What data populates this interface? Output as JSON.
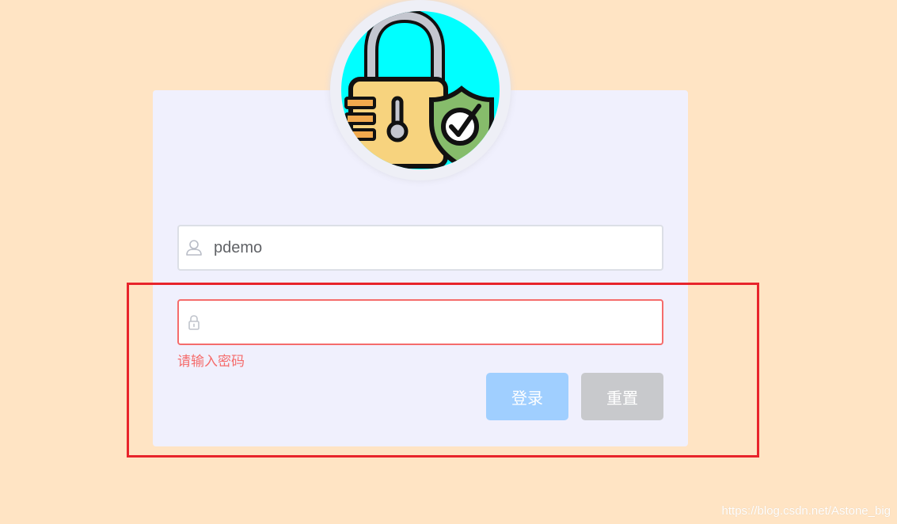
{
  "login": {
    "username_value": "pdemo",
    "username_placeholder": "",
    "password_value": "",
    "password_placeholder": "",
    "password_error": "请输入密码",
    "login_button": "登录",
    "reset_button": "重置"
  },
  "avatar": {
    "icon": "padlock-shield-icon",
    "background_color": "#00ffff"
  },
  "watermark": "https://blog.csdn.net/Astone_big",
  "colors": {
    "page_background": "#ffe4c4",
    "card_background": "#f0f0fd",
    "error": "#f56c6c",
    "primary_disabled": "#a0cfff",
    "reset_button": "#c8c9cc",
    "highlight_border": "#e8242b"
  }
}
